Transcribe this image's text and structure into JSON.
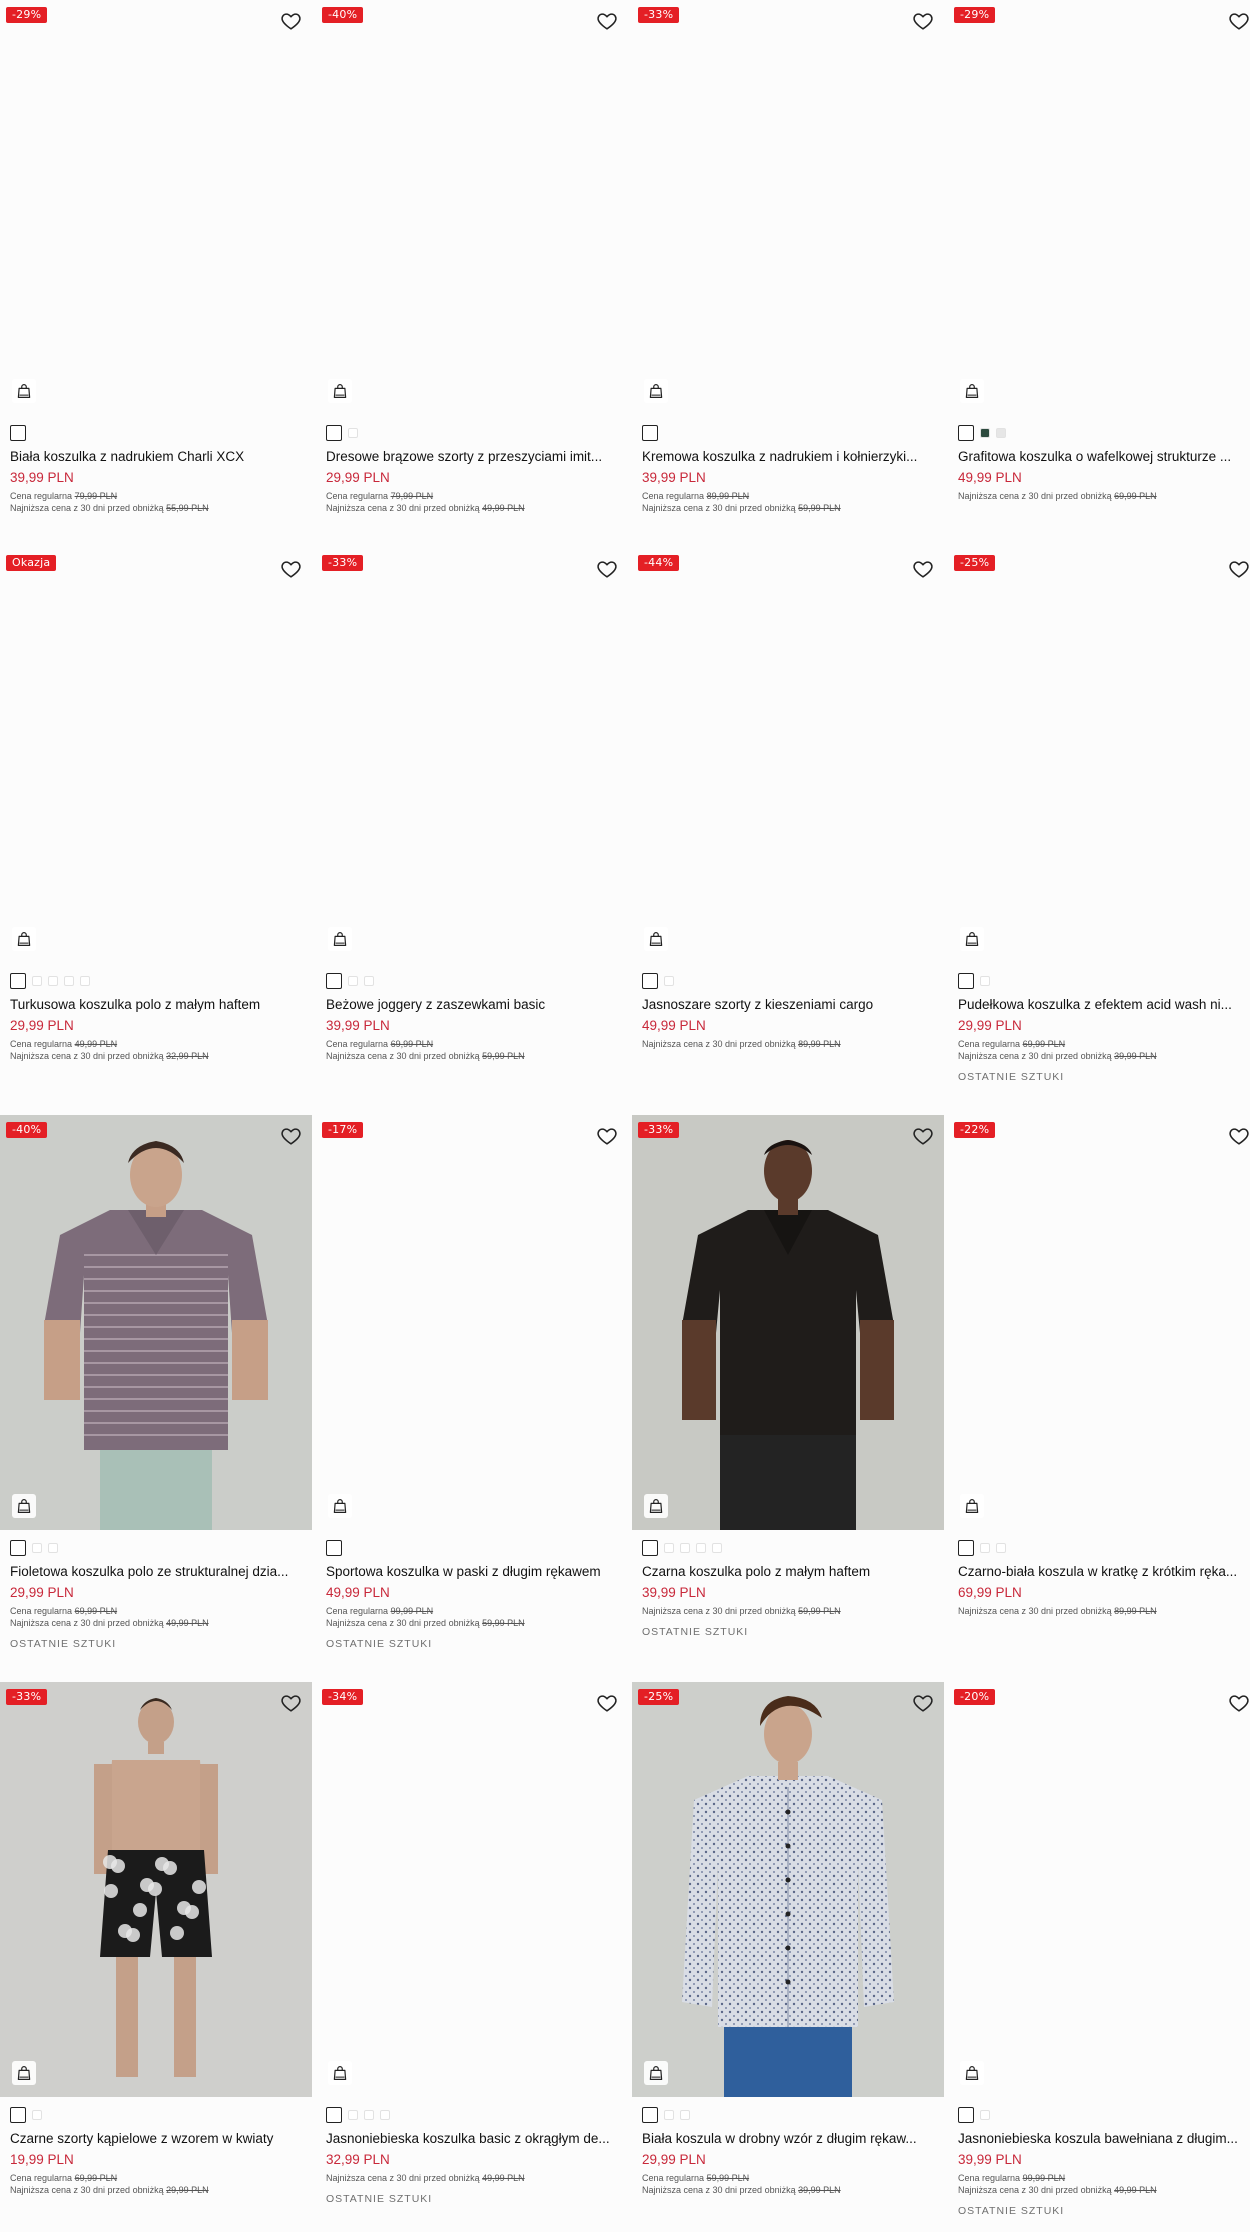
{
  "colors": {
    "badge": "#e41f25",
    "price": "#c8283a"
  },
  "icons": {
    "wishlist": "heart-icon",
    "cart": "shopping-bag-icon"
  },
  "products": [
    {
      "badge": "-29%",
      "title": "Biała koszulka z nadrukiem Charli XCX",
      "price": "39,99 PLN",
      "regular_label": "Cena regularna",
      "regular_price": "79,99 PLN",
      "lowest_label": "Najniższa cena z 30 dni przed obniżką",
      "lowest_price": "55,99 PLN",
      "stock": "",
      "swatches": [
        "#ffffff"
      ],
      "photo": "none"
    },
    {
      "badge": "-40%",
      "title": "Dresowe brązowe szorty z przeszyciami imit...",
      "price": "29,99 PLN",
      "regular_label": "Cena regularna",
      "regular_price": "79,99 PLN",
      "lowest_label": "Najniższa cena z 30 dni przed obniżką",
      "lowest_price": "49,99 PLN",
      "stock": "",
      "swatches": [
        "#ffffff",
        "#ffffff"
      ],
      "photo": "none"
    },
    {
      "badge": "-33%",
      "title": "Kremowa koszulka z nadrukiem i kołnierzyki...",
      "price": "39,99 PLN",
      "regular_label": "Cena regularna",
      "regular_price": "89,99 PLN",
      "lowest_label": "Najniższa cena z 30 dni przed obniżką",
      "lowest_price": "59,99 PLN",
      "stock": "",
      "swatches": [
        "#ffffff"
      ],
      "photo": "none"
    },
    {
      "badge": "-29%",
      "title": "Grafitowa koszulka o wafelkowej strukturze ...",
      "price": "49,99 PLN",
      "regular_label": "",
      "regular_price": "",
      "lowest_label": "Najniższa cena z 30 dni przed obniżką",
      "lowest_price": "69,99 PLN",
      "stock": "",
      "swatches": [
        "#1a1a1a",
        "#2c4a3e",
        "#e6e6e6"
      ],
      "photo": "none"
    },
    {
      "badge": "Okazja",
      "title": "Turkusowa koszulka polo z małym haftem",
      "price": "29,99 PLN",
      "regular_label": "Cena regularna",
      "regular_price": "49,99 PLN",
      "lowest_label": "Najniższa cena z 30 dni przed obniżką",
      "lowest_price": "32,99 PLN",
      "stock": "",
      "swatches": [
        "#ffffff",
        "#ffffff",
        "#ffffff",
        "#ffffff",
        "#ffffff"
      ],
      "photo": "none"
    },
    {
      "badge": "-33%",
      "title": "Beżowe joggery z zaszewkami basic",
      "price": "39,99 PLN",
      "regular_label": "Cena regularna",
      "regular_price": "69,99 PLN",
      "lowest_label": "Najniższa cena z 30 dni przed obniżką",
      "lowest_price": "59,99 PLN",
      "stock": "",
      "swatches": [
        "#ffffff",
        "#ffffff",
        "#ffffff"
      ],
      "photo": "none"
    },
    {
      "badge": "-44%",
      "title": "Jasnoszare szorty z kieszeniami cargo",
      "price": "49,99 PLN",
      "regular_label": "",
      "regular_price": "",
      "lowest_label": "Najniższa cena z 30 dni przed obniżką",
      "lowest_price": "89,99 PLN",
      "stock": "",
      "swatches": [
        "#ffffff",
        "#ffffff"
      ],
      "photo": "none"
    },
    {
      "badge": "-25%",
      "title": "Pudełkowa koszulka z efektem acid wash ni...",
      "price": "29,99 PLN",
      "regular_label": "Cena regularna",
      "regular_price": "69,99 PLN",
      "lowest_label": "Najniższa cena z 30 dni przed obniżką",
      "lowest_price": "39,99 PLN",
      "stock": "OSTATNIE SZTUKI",
      "swatches": [
        "#ffffff",
        "#ffffff"
      ],
      "photo": "none"
    },
    {
      "badge": "-40%",
      "title": "Fioletowa koszulka polo ze strukturalnej dzia...",
      "price": "29,99 PLN",
      "regular_label": "Cena regularna",
      "regular_price": "69,99 PLN",
      "lowest_label": "Najniższa cena z 30 dni przed obniżką",
      "lowest_price": "49,99 PLN",
      "stock": "OSTATNIE SZTUKI",
      "swatches": [
        "#ffffff",
        "#ffffff",
        "#ffffff"
      ],
      "photo": "polo-purple"
    },
    {
      "badge": "-17%",
      "title": "Sportowa koszulka w paski z długim rękawem",
      "price": "49,99 PLN",
      "regular_label": "Cena regularna",
      "regular_price": "99,99 PLN",
      "lowest_label": "Najniższa cena z 30 dni przed obniżką",
      "lowest_price": "59,99 PLN",
      "stock": "OSTATNIE SZTUKI",
      "swatches": [
        "#ffffff"
      ],
      "photo": "none"
    },
    {
      "badge": "-33%",
      "title": "Czarna koszulka polo z małym haftem",
      "price": "39,99 PLN",
      "regular_label": "",
      "regular_price": "",
      "lowest_label": "Najniższa cena z 30 dni przed obniżką",
      "lowest_price": "59,99 PLN",
      "stock": "OSTATNIE SZTUKI",
      "swatches": [
        "#ffffff",
        "#ffffff",
        "#ffffff",
        "#ffffff",
        "#ffffff"
      ],
      "photo": "polo-black"
    },
    {
      "badge": "-22%",
      "title": "Czarno-biała koszula w kratkę z krótkim ręka...",
      "price": "69,99 PLN",
      "regular_label": "",
      "regular_price": "",
      "lowest_label": "Najniższa cena z 30 dni przed obniżką",
      "lowest_price": "89,99 PLN",
      "stock": "",
      "swatches": [
        "#ffffff",
        "#ffffff",
        "#ffffff"
      ],
      "photo": "none"
    },
    {
      "badge": "-33%",
      "title": "Czarne szorty kąpielowe z wzorem w kwiaty",
      "price": "19,99 PLN",
      "regular_label": "Cena regularna",
      "regular_price": "69,99 PLN",
      "lowest_label": "Najniższa cena z 30 dni przed obniżką",
      "lowest_price": "29,99 PLN",
      "stock": "",
      "swatches": [
        "#ffffff",
        "#ffffff"
      ],
      "photo": "swim-shorts"
    },
    {
      "badge": "-34%",
      "title": "Jasnoniebieska koszulka basic z okrągłym de...",
      "price": "32,99 PLN",
      "regular_label": "",
      "regular_price": "",
      "lowest_label": "Najniższa cena z 30 dni przed obniżką",
      "lowest_price": "49,99 PLN",
      "stock": "OSTATNIE SZTUKI",
      "swatches": [
        "#ffffff",
        "#ffffff",
        "#ffffff",
        "#ffffff"
      ],
      "photo": "none"
    },
    {
      "badge": "-25%",
      "title": "Biała koszula w drobny wzór z długim rękaw...",
      "price": "29,99 PLN",
      "regular_label": "Cena regularna",
      "regular_price": "59,99 PLN",
      "lowest_label": "Najniższa cena z 30 dni przed obniżką",
      "lowest_price": "39,99 PLN",
      "stock": "",
      "swatches": [
        "#ffffff",
        "#ffffff",
        "#ffffff"
      ],
      "photo": "shirt-print"
    },
    {
      "badge": "-20%",
      "title": "Jasnoniebieska koszula bawełniana z długim...",
      "price": "39,99 PLN",
      "regular_label": "Cena regularna",
      "regular_price": "99,99 PLN",
      "lowest_label": "Najniższa cena z 30 dni przed obniżką",
      "lowest_price": "49,99 PLN",
      "stock": "OSTATNIE SZTUKI",
      "swatches": [
        "#ffffff",
        "#ffffff"
      ],
      "photo": "none"
    }
  ]
}
